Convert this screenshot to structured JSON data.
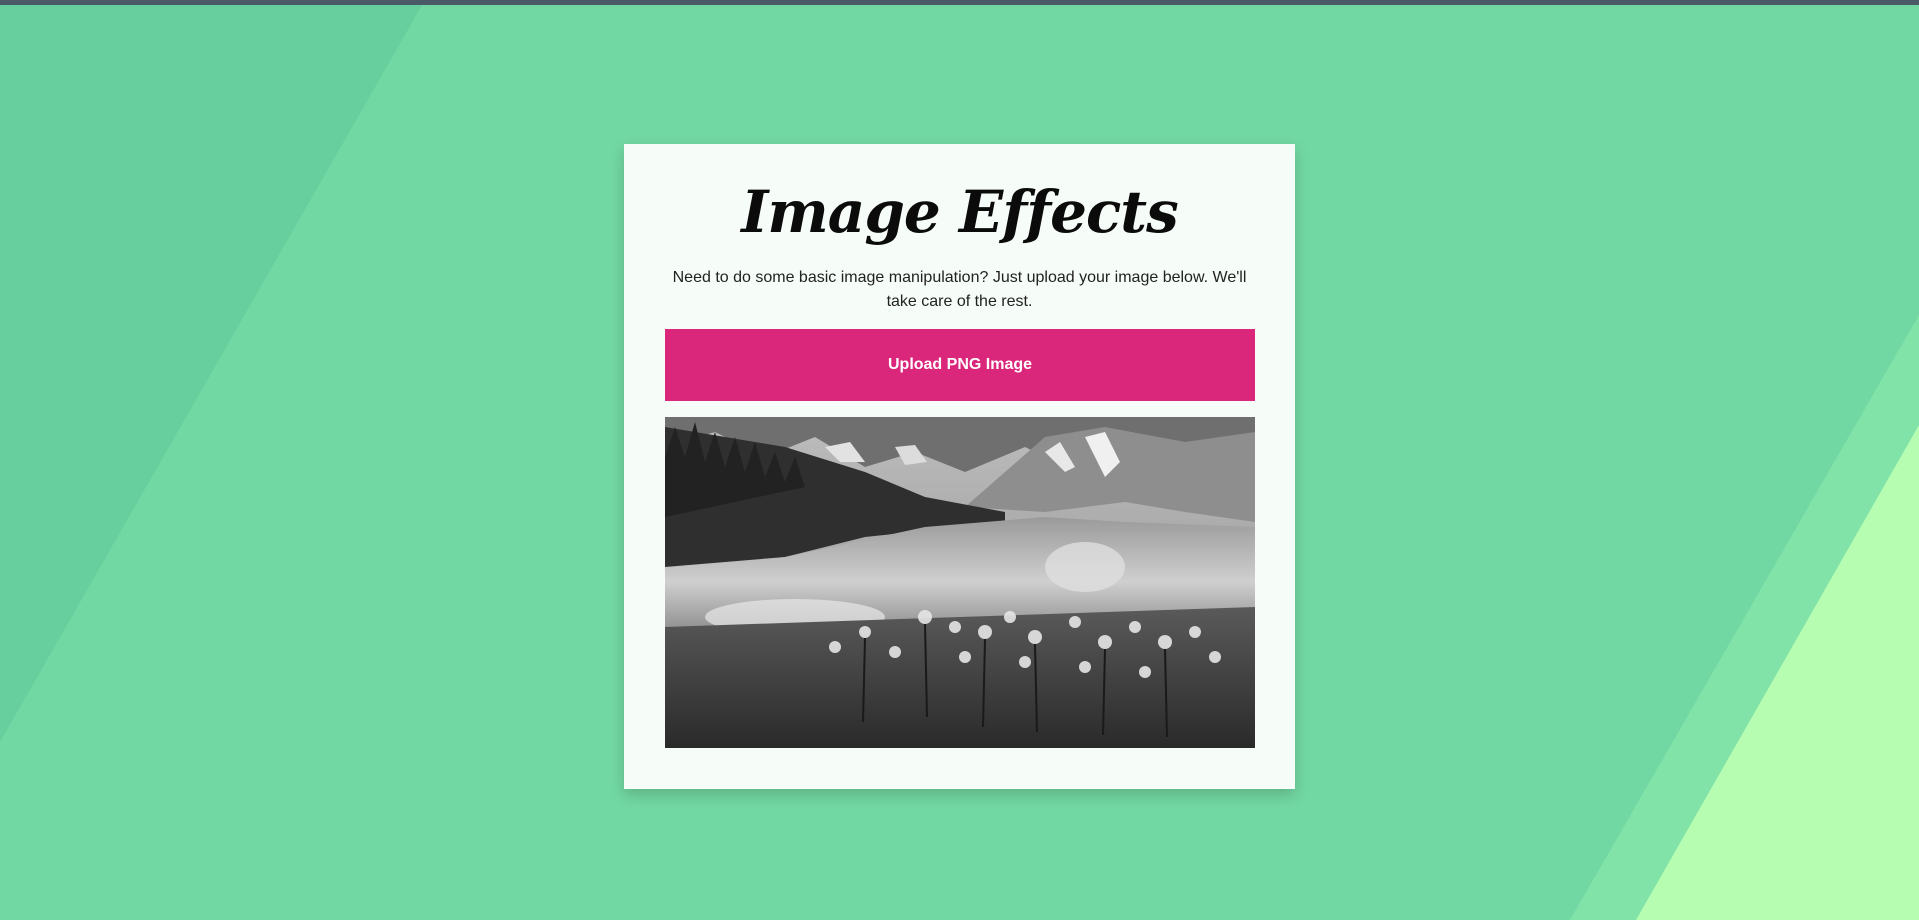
{
  "page": {
    "title": "Image Effects",
    "description": "Need to do some basic image manipulation? Just upload your image below. We'll take care of the rest.",
    "upload_label": "Upload PNG Image"
  },
  "preview": {
    "description_icon": "grayscale-lake-landscape-image"
  },
  "colors": {
    "background": "#72d8a3",
    "background_dark_stripe": "#68d09c",
    "background_light_stripe": "#b6fdb1",
    "card": "#f6fcf8",
    "upload_button": "#da277b",
    "top_strip": "#4a5a66"
  }
}
